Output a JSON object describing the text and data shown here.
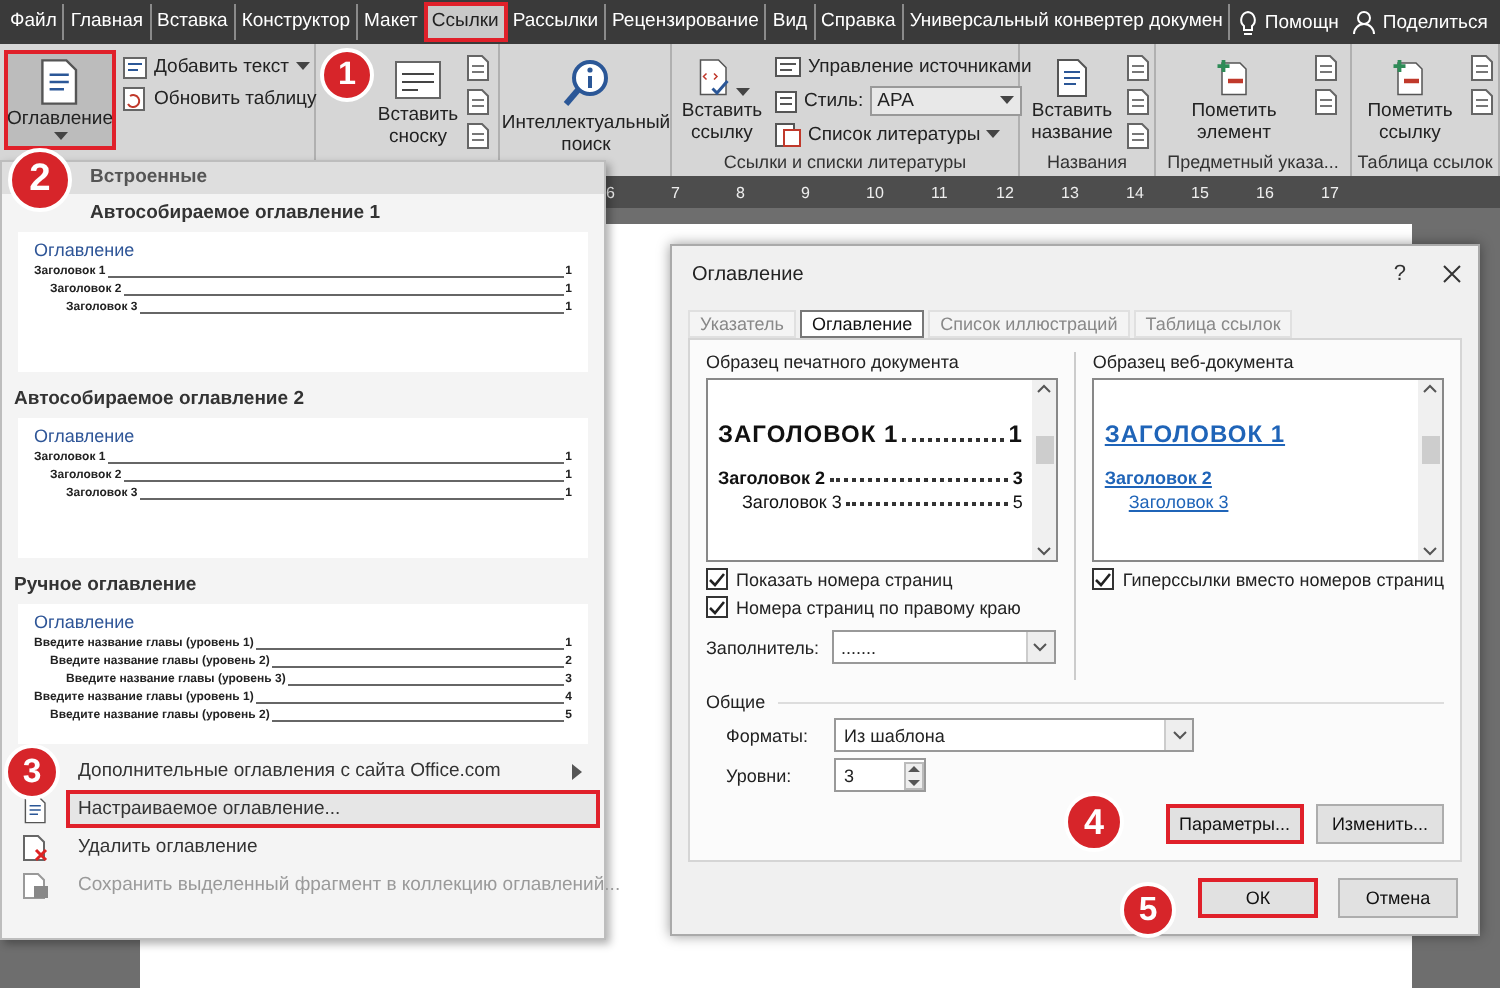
{
  "menu_tabs": [
    {
      "label": "Файл",
      "selected": false,
      "highlighted": false
    },
    {
      "label": "Главная",
      "selected": false,
      "highlighted": false
    },
    {
      "label": "Вставка",
      "selected": false,
      "highlighted": false
    },
    {
      "label": "Конструктор",
      "selected": false,
      "highlighted": false
    },
    {
      "label": "Макет",
      "selected": false,
      "highlighted": false
    },
    {
      "label": "Ссылки",
      "selected": true,
      "highlighted": true
    },
    {
      "label": "Рассылки",
      "selected": false,
      "highlighted": false
    },
    {
      "label": "Рецензирование",
      "selected": false,
      "highlighted": false
    },
    {
      "label": "Вид",
      "selected": false,
      "highlighted": false
    },
    {
      "label": "Справка",
      "selected": false,
      "highlighted": false
    },
    {
      "label": "Универсальный конвертер докумен",
      "selected": false,
      "highlighted": false
    }
  ],
  "help": "Помощн",
  "share": "Поделиться",
  "ribbon": {
    "toc": {
      "label": "Оглавление",
      "selected": true,
      "highlighted": true
    },
    "toc_actions": [
      {
        "label": "Добавить текст",
        "dropdown": true
      },
      {
        "label": "Обновить таблицу",
        "dropdown": false
      }
    ],
    "footnote": "Вставить сноску",
    "search": "Интеллектуальный поиск",
    "citations": {
      "insert": "Вставить ссылку",
      "manage": "Управление источниками",
      "style_label": "Стиль:",
      "style_value": "APA",
      "bibliography": "Список литературы",
      "group": "Ссылки и списки литературы"
    },
    "captions": {
      "insert": "Вставить название",
      "group": "Названия"
    },
    "index": {
      "mark": "Пометить элемент",
      "group": "Предметный указа..."
    },
    "authorities": {
      "mark": "Пометить ссылку",
      "group": "Таблица ссылок"
    }
  },
  "ruler": [
    "6",
    "7",
    "8",
    "9",
    "10",
    "11",
    "12",
    "13",
    "14",
    "15",
    "16",
    "17"
  ],
  "toc_menu": {
    "header": "Встроенные",
    "sections": [
      {
        "title": "Автособираемое оглавление 1",
        "heading": "Оглавление",
        "entries": [
          {
            "text": "Заголовок 1",
            "page": "1",
            "children": [
              {
                "text": "Заголовок 2",
                "page": "1",
                "children": [
                  {
                    "text": "Заголовок 3",
                    "page": "1"
                  }
                ]
              }
            ]
          }
        ]
      },
      {
        "title": "Автособираемое оглавление 2",
        "heading": "Оглавление",
        "entries": [
          {
            "text": "Заголовок 1",
            "page": "1",
            "children": [
              {
                "text": "Заголовок 2",
                "page": "1",
                "children": [
                  {
                    "text": "Заголовок 3",
                    "page": "1"
                  }
                ]
              }
            ]
          }
        ]
      },
      {
        "title": "Ручное оглавление",
        "heading": "Оглавление",
        "entries": [
          {
            "text": "Введите название главы (уровень 1)",
            "page": "1",
            "children": [
              {
                "text": "Введите название главы (уровень 2)",
                "page": "2",
                "children": [
                  {
                    "text": "Введите название главы (уровень 3)",
                    "page": "3"
                  }
                ]
              }
            ]
          },
          {
            "text": "Введите название главы (уровень 1)",
            "page": "4",
            "children": [
              {
                "text": "Введите название главы (уровень 2)",
                "page": "5"
              }
            ]
          }
        ]
      }
    ],
    "items": [
      {
        "label": "Дополнительные оглавления с сайта Office.com",
        "kind": "submenu",
        "highlighted": false,
        "disabled": false
      },
      {
        "label": "Настраиваемое оглавление...",
        "kind": "item",
        "highlighted": true,
        "disabled": false
      },
      {
        "label": "Удалить оглавление",
        "kind": "item",
        "highlighted": false,
        "disabled": false
      },
      {
        "label": "Сохранить выделенный фрагмент в коллекцию оглавлений...",
        "kind": "item",
        "highlighted": false,
        "disabled": true
      }
    ]
  },
  "dialog": {
    "title": "Оглавление",
    "help": "?",
    "tabs": [
      {
        "label": "Указатель",
        "selected": false
      },
      {
        "label": "Оглавление",
        "selected": true
      },
      {
        "label": "Список иллюстраций",
        "selected": false
      },
      {
        "label": "Таблица ссылок",
        "selected": false
      }
    ],
    "print_preview": {
      "label": "Образец печатного документа",
      "entries": [
        {
          "text": "ЗАГОЛОВОК 1",
          "page": "1",
          "children": [
            {
              "text": "Заголовок 2",
              "page": "3",
              "children": [
                {
                  "text": "Заголовок 3",
                  "page": "5"
                }
              ]
            }
          ]
        }
      ]
    },
    "web_preview": {
      "label": "Образец веб-документа",
      "entries": [
        {
          "text": "ЗАГОЛОВОК 1",
          "children": [
            {
              "text": "Заголовок 2",
              "children": [
                {
                  "text": "Заголовок 3"
                }
              ]
            }
          ]
        }
      ]
    },
    "options": [
      {
        "label": "Показать номера страниц",
        "checked": true
      },
      {
        "label": "Номера страниц по правому краю",
        "checked": true
      }
    ],
    "hyperlinks": {
      "label": "Гиперссылки вместо номеров страниц",
      "checked": true
    },
    "leader": {
      "label": "Заполнитель:",
      "value": "......."
    },
    "general": {
      "title": "Общие",
      "formats_label": "Форматы:",
      "formats_value": "Из шаблона",
      "levels_label": "Уровни:",
      "levels_value": "3"
    },
    "buttons": [
      {
        "label": "Параметры...",
        "highlighted": true
      },
      {
        "label": "Изменить...",
        "highlighted": false
      }
    ],
    "footer_buttons": [
      {
        "label": "ОК",
        "highlighted": true
      },
      {
        "label": "Отмена",
        "highlighted": false
      }
    ]
  },
  "steps": [
    "1",
    "2",
    "3",
    "4",
    "5"
  ]
}
